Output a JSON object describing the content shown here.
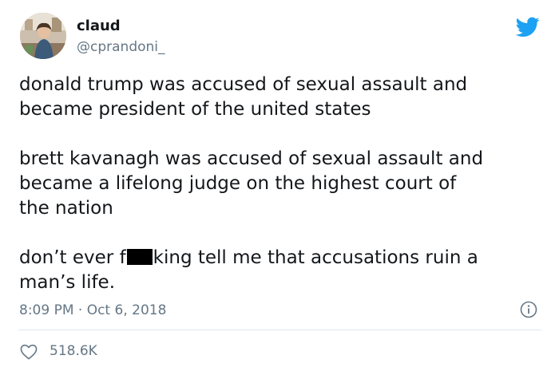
{
  "user": {
    "display_name": "claud",
    "handle": "@cprandoni_",
    "avatar_icon": "profile-photo"
  },
  "tweet": {
    "paragraph1": {
      "line1": "donald trump was accused of sexual assault and",
      "line2": "became president of the united states"
    },
    "paragraph2": {
      "line1": "brett kavanagh was accused of sexual assault and",
      "line2": "became a lifelong judge on the highest court of",
      "line3": "the nation"
    },
    "paragraph3": {
      "line1_prefix": "don’t ever f",
      "line1_suffix": "king tell me that accusations ruin a",
      "line2": "man’s life."
    },
    "timestamp": "8:09 PM · Oct 6, 2018",
    "likes": "518.6K"
  },
  "icons": {
    "brand": "twitter-bird-icon",
    "info": "info-icon",
    "like": "heart-icon"
  },
  "colors": {
    "brand_blue": "#1da1f2",
    "text": "#14171a",
    "muted": "#657786",
    "divider": "#e1e8ed"
  }
}
